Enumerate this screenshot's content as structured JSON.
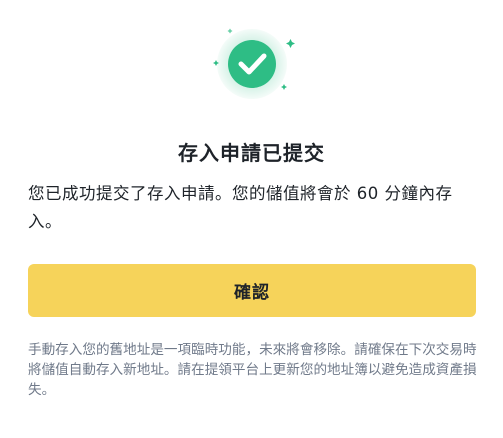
{
  "dialog": {
    "icon": "success-check-icon",
    "title": "存入申請已提交",
    "message": "您已成功提交了存入申請。您的儲值將會於 60 分鐘內存入。",
    "confirm_label": "確認",
    "notice": "手動存入您的舊地址是一項臨時功能，未來將會移除。請確保在下次交易時將儲值自動存入新地址。請在提領平台上更新您的地址簿以避免造成資產損失。"
  },
  "colors": {
    "success_green": "#2ebd85",
    "button_yellow": "#f6d35a",
    "text_primary": "#1e2329",
    "text_secondary": "#707a8a"
  }
}
